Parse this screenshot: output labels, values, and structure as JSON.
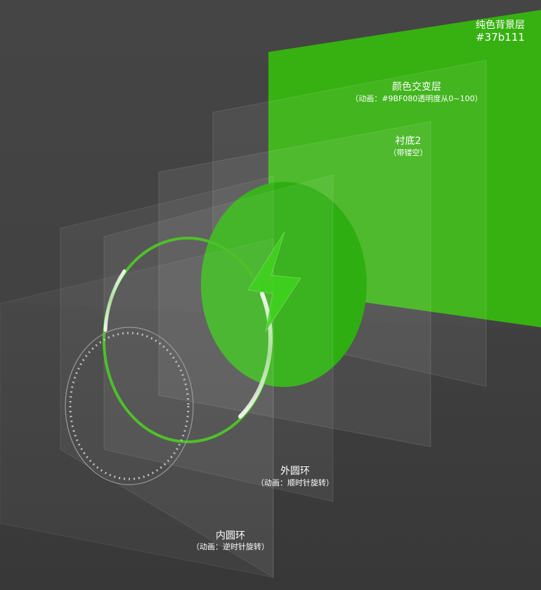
{
  "layers": {
    "background": {
      "title": "纯色背景层",
      "code": "#37b111",
      "color": "#37b111"
    },
    "color_change": {
      "title": "颜色交变层",
      "subtitle": "（动画：#9BF080透明度从0~100）",
      "color": "#9BF080"
    },
    "base2": {
      "title": "衬底2",
      "subtitle": "（带镂空）"
    },
    "outer_ring": {
      "title": "外圆环",
      "subtitle": "（动画：顺时针旋转）"
    },
    "inner_ring": {
      "title": "内圆环",
      "subtitle": "（动画：逆时针旋转）"
    }
  },
  "icon": {
    "name": "lightning-bolt-icon"
  },
  "colors": {
    "ring_green": "#4fc02a",
    "disc_green": "#2fae12",
    "bolt_green": "#3fd21e"
  }
}
